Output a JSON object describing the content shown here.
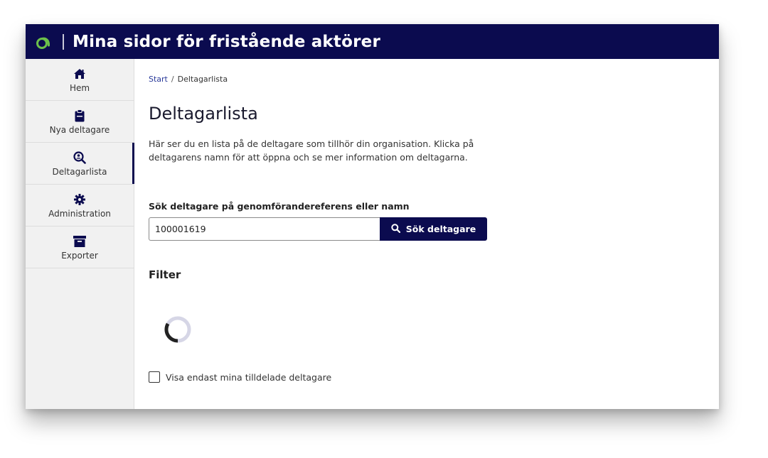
{
  "header": {
    "title": "Mina sidor för fristående aktörer",
    "logo_icon": "af-logo-icon",
    "background": "#0b0b4f",
    "logo_color": "#6cc04a"
  },
  "sidebar": {
    "items": [
      {
        "label": "Hem",
        "icon": "home-icon"
      },
      {
        "label": "Nya deltagare",
        "icon": "clipboard-icon"
      },
      {
        "label": "Deltagarlista",
        "icon": "search-person-icon",
        "active": true
      },
      {
        "label": "Administration",
        "icon": "gear-icon"
      },
      {
        "label": "Exporter",
        "icon": "archive-icon"
      }
    ]
  },
  "breadcrumb": {
    "start": "Start",
    "separator": "/",
    "current": "Deltagarlista"
  },
  "main": {
    "title": "Deltagarlista",
    "intro": "Här ser du en lista på de deltagare som tillhör din organisation. Klicka på deltagarens namn för att öppna och se mer information om deltagarna.",
    "search_label": "Sök deltagare på genomförandereferens eller namn",
    "search_value": "100001619",
    "search_button": "Sök deltagare",
    "filter_heading": "Filter",
    "checkbox_label": "Visa endast mina tilldelade deltagare"
  }
}
